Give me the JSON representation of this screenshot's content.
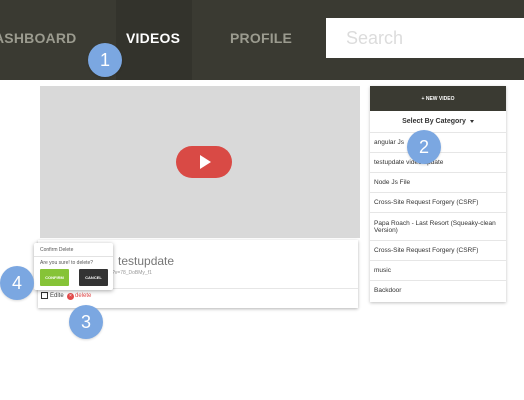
{
  "nav": {
    "items": [
      "ASHBOARD",
      "VIDEOS",
      "PROFILE"
    ],
    "search_placeholder": "Search"
  },
  "video": {
    "title": "testupdate",
    "url": "?v=78_DoBMy_f1",
    "edit_label": "Edite",
    "delete_label": "delete"
  },
  "confirm": {
    "title": "Confirm Delete",
    "question": "Are you sure! to delete?",
    "confirm_label": "CONFIRM",
    "cancel_label": "CANCEL"
  },
  "sidebar": {
    "new_video_label": "+ NEW VIDEO",
    "select_category_label": "Select By Category",
    "categories": [
      "angular Js",
      "testupdate video update",
      "Node Js File",
      "Cross-Site Request Forgery (CSRF)",
      "Papa Roach - Last Resort (Squeaky-clean Version)",
      "Cross-Site Request Forgery (CSRF)",
      "music",
      "Backdoor"
    ]
  },
  "badges": [
    "1",
    "2",
    "3",
    "4"
  ],
  "colors": {
    "nav_bg": "#3a3a32",
    "play_red": "#d94a45",
    "confirm_green": "#86c337",
    "cancel_dark": "#333333",
    "delete_red": "#e24a4a",
    "badge_blue": "#7ba7e1"
  },
  "icons": {
    "play": "play-icon",
    "edit": "edit-icon",
    "delete": "delete-icon",
    "caret": "caret-down-icon"
  }
}
